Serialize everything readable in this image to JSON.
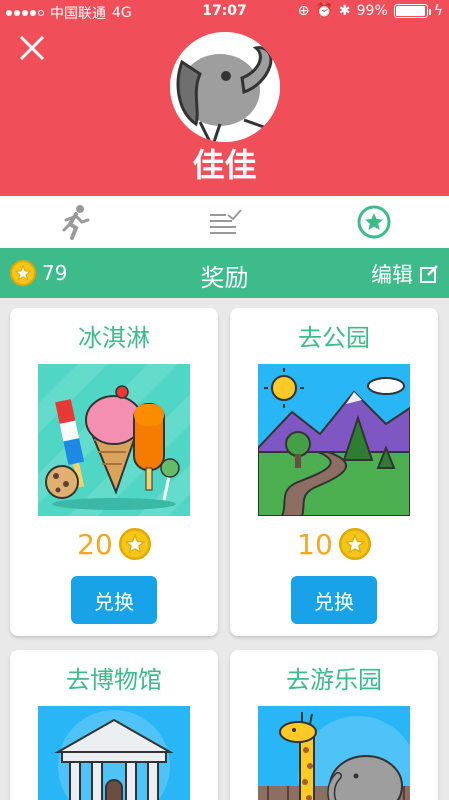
{
  "status_bar": {
    "carrier": "中国联通",
    "network": "4G",
    "time": "17:07",
    "battery": "99%",
    "battery_level": 0.99
  },
  "profile": {
    "name": "佳佳"
  },
  "tabs": [
    {
      "icon": "running-person-icon"
    },
    {
      "icon": "checklist-icon"
    },
    {
      "icon": "star-circle-icon",
      "active": true
    }
  ],
  "reward_bar": {
    "coins": "79",
    "title": "奖励",
    "edit_label": "编辑"
  },
  "rewards": [
    {
      "title": "冰淇淋",
      "cost": "20",
      "button": "兑换",
      "image": "ice-cream-illustration"
    },
    {
      "title": "去公园",
      "cost": "10",
      "button": "兑换",
      "image": "park-illustration"
    },
    {
      "title": "去博物馆",
      "image": "museum-illustration"
    },
    {
      "title": "去游乐园",
      "image": "zoo-illustration"
    }
  ],
  "colors": {
    "header": "#f04e58",
    "accent_green": "#3dbb8b",
    "button_blue": "#18a3e8",
    "coin_orange": "#f5a623"
  }
}
